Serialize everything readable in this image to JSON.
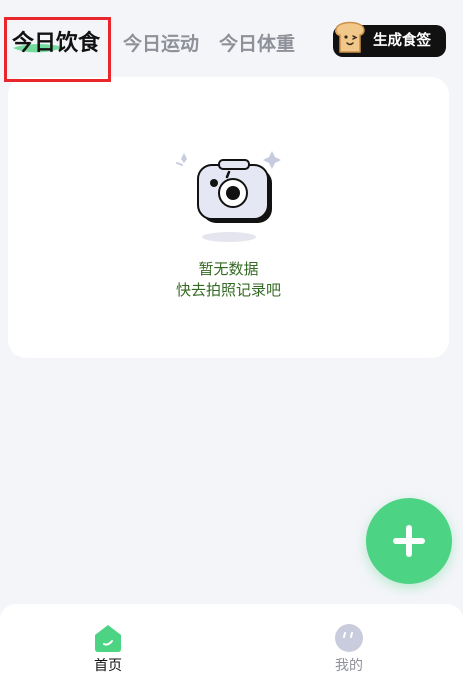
{
  "header": {
    "tabs": [
      {
        "label": "今日饮食",
        "active": true
      },
      {
        "label": "今日运动",
        "active": false
      },
      {
        "label": "今日体重",
        "active": false
      }
    ],
    "generate_button": {
      "label": "生成食签",
      "icon": "toast-icon"
    }
  },
  "empty_state": {
    "icon": "camera-icon",
    "title": "暂无数据",
    "subtitle": "快去拍照记录吧"
  },
  "fab": {
    "icon": "plus-icon"
  },
  "bottom_nav": {
    "items": [
      {
        "label": "首页",
        "icon": "home-icon",
        "active": true
      },
      {
        "label": "我的",
        "icon": "profile-icon",
        "active": false
      }
    ]
  },
  "colors": {
    "accent": "#4cd383",
    "background": "#f4f5f9",
    "empty_text": "#356a24",
    "inactive_tab": "#8f9199",
    "highlight_box": "#e8262b"
  }
}
